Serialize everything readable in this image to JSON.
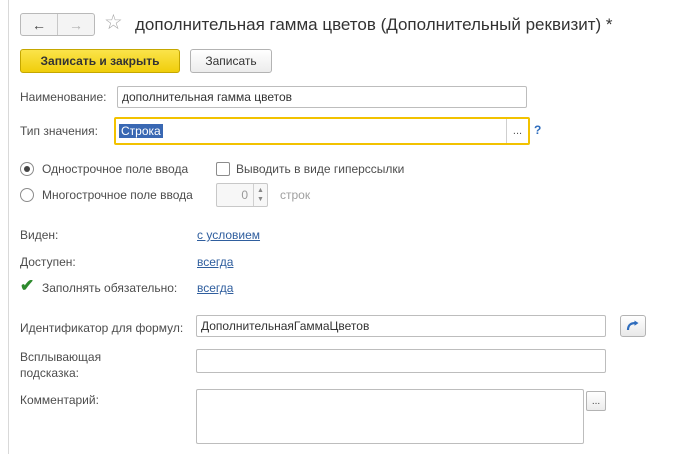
{
  "window": {
    "title": "дополнительная гамма цветов (Дополнительный реквизит) *",
    "back_glyph": "←",
    "forward_glyph": "→",
    "star_glyph": "☆"
  },
  "toolbar": {
    "save_close_label": "Записать и закрыть",
    "save_label": "Записать"
  },
  "form": {
    "name_label": "Наименование:",
    "name_value": "дополнительная гамма цветов",
    "type_label": "Тип значения:",
    "type_value": "Строка",
    "ellipsis": "...",
    "help": "?",
    "single_line_label": "Однострочное поле ввода",
    "hyperlink_label": "Выводить в виде гиперссылки",
    "multi_line_label": "Многострочное поле ввода",
    "lines_value": "0",
    "lines_unit": "строк",
    "visible_label": "Виден:",
    "visible_value": "с условием",
    "enabled_label": "Доступен:",
    "enabled_value": "всегда",
    "required_label": "Заполнять обязательно:",
    "required_value": "всегда",
    "check_glyph": "✔",
    "formula_id_label": "Идентификатор для формул:",
    "formula_id_value": "ДополнительнаяГаммаЦветов",
    "tooltip_label_1": "Всплывающая",
    "tooltip_label_2": "подсказка:",
    "tooltip_value": "",
    "comment_label": "Комментарий:",
    "comment_value": ""
  },
  "colors": {
    "accent": "#f0ce0b",
    "focus_border": "#f2c200",
    "link": "#2f5e9e",
    "selection": "#3968b3"
  }
}
